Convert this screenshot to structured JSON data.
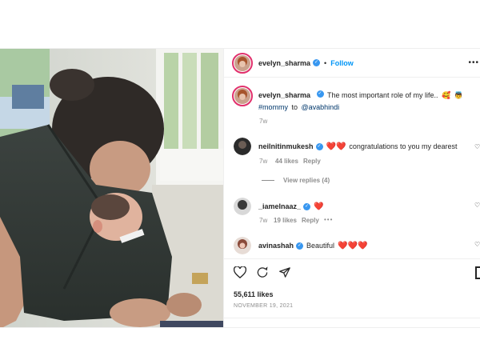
{
  "header": {
    "username": "evelyn_sharma",
    "separator": "•",
    "follow_label": "Follow",
    "more_icon": "more-horizontal-icon"
  },
  "caption": {
    "username": "evelyn_sharma",
    "text": "The most important role of my life..",
    "emoji1": "🥰",
    "emoji2": "👼",
    "hashtag": "#mommy",
    "to_text": "to",
    "mention": "@avabhindi",
    "time": "7w"
  },
  "comments": [
    {
      "username": "neilnitinmukesh",
      "verified": true,
      "hearts": "❤️❤️",
      "text": "congratulations to you my dearest",
      "time": "7w",
      "likes": "44 likes",
      "reply": "Reply",
      "view_replies": "View replies (4)"
    },
    {
      "username": "_iamelnaaz_",
      "verified": true,
      "hearts": "❤️",
      "text": "",
      "time": "7w",
      "likes": "19 likes",
      "reply": "Reply",
      "more": "•••"
    },
    {
      "username": "avinashah",
      "verified": true,
      "text": "Beautiful",
      "hearts": "❤️❤️❤️"
    }
  ],
  "actions": {
    "likes": "55,611 likes",
    "date": "NOVEMBER 19, 2021"
  },
  "colors": {
    "accent": "#0095f6",
    "verified": "#3897f0",
    "heart": "#ed4956",
    "muted": "#8e8e8e"
  }
}
